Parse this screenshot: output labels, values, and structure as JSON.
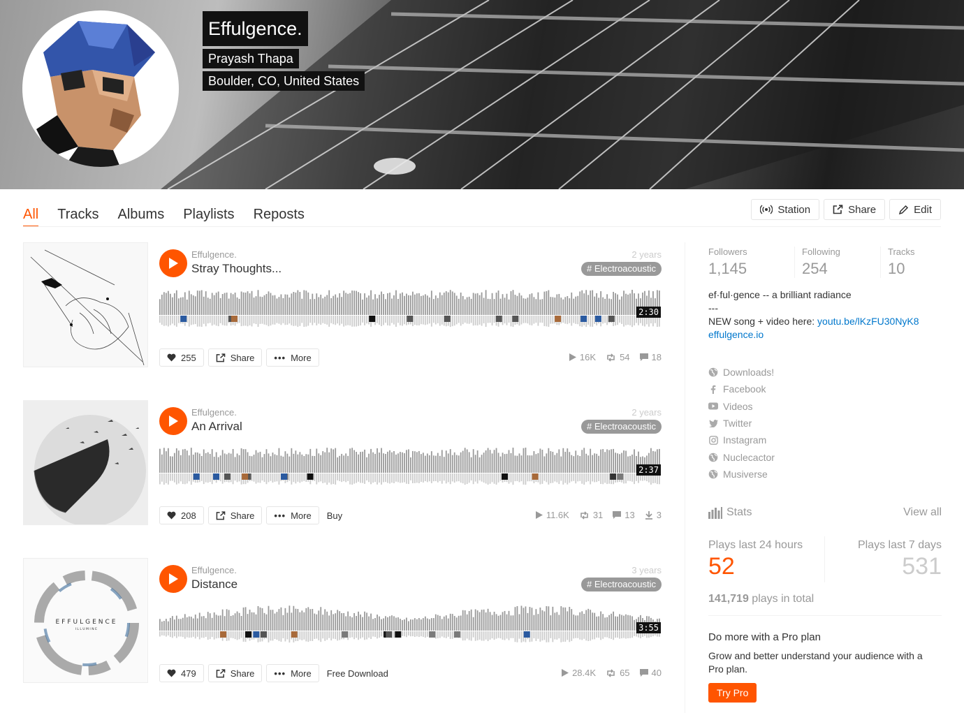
{
  "profile": {
    "title": "Effulgence.",
    "name": "Prayash Thapa",
    "location": "Boulder, CO, United States"
  },
  "tabs": [
    "All",
    "Tracks",
    "Albums",
    "Playlists",
    "Reposts"
  ],
  "header_buttons": {
    "station": "Station",
    "share": "Share",
    "edit": "Edit"
  },
  "tracks": [
    {
      "user": "Effulgence.",
      "title": "Stray Thoughts...",
      "age": "2 years",
      "tag": "Electroacoustic",
      "duration": "2:30",
      "likes": "255",
      "share": "Share",
      "more": "More",
      "extra": "",
      "plays": "16K",
      "reposts": "54",
      "comments": "18",
      "downloads": ""
    },
    {
      "user": "Effulgence.",
      "title": "An Arrival",
      "age": "2 years",
      "tag": "Electroacoustic",
      "duration": "2:37",
      "likes": "208",
      "share": "Share",
      "more": "More",
      "extra": "Buy",
      "plays": "11.6K",
      "reposts": "31",
      "comments": "13",
      "downloads": "3"
    },
    {
      "user": "Effulgence.",
      "title": "Distance",
      "age": "3 years",
      "tag": "Electroacoustic",
      "duration": "3:55",
      "likes": "479",
      "share": "Share",
      "more": "More",
      "extra": "Free Download",
      "plays": "28.4K",
      "reposts": "65",
      "comments": "40",
      "downloads": ""
    }
  ],
  "artwork_text": {
    "brand": "EFFULGENCE",
    "sub": "ILLUMINE"
  },
  "sidebar": {
    "followers_label": "Followers",
    "followers": "1,145",
    "following_label": "Following",
    "following": "254",
    "tracks_label": "Tracks",
    "tracks": "10",
    "bio_line1": "ef·ful·gence -- a brilliant radiance",
    "bio_line2": "---",
    "bio_line3": "NEW song + video here: ",
    "bio_link1": "youtu.be/lKzFU30NyK8",
    "bio_link2": "effulgence.io",
    "links": [
      {
        "label": "Downloads!",
        "icon": "globe-icon"
      },
      {
        "label": "Facebook",
        "icon": "facebook-icon"
      },
      {
        "label": "Videos",
        "icon": "youtube-icon"
      },
      {
        "label": "Twitter",
        "icon": "twitter-icon"
      },
      {
        "label": "Instagram",
        "icon": "instagram-icon"
      },
      {
        "label": "Nuclecactor",
        "icon": "globe-icon"
      },
      {
        "label": "Musiverse",
        "icon": "globe-icon"
      }
    ],
    "stats_label": "Stats",
    "view_all": "View all",
    "plays24_label": "Plays last 24 hours",
    "plays24": "52",
    "plays7_label": "Plays last 7 days",
    "plays7": "531",
    "total_plays": "141,719",
    "total_suffix": " plays in total",
    "pro_title": "Do more with a Pro plan",
    "pro_text": "Grow and better understand your audience with a Pro plan.",
    "try_pro": "Try Pro"
  },
  "colors": {
    "accent": "#ff5500",
    "link": "#0077cc",
    "muted": "#999999"
  }
}
